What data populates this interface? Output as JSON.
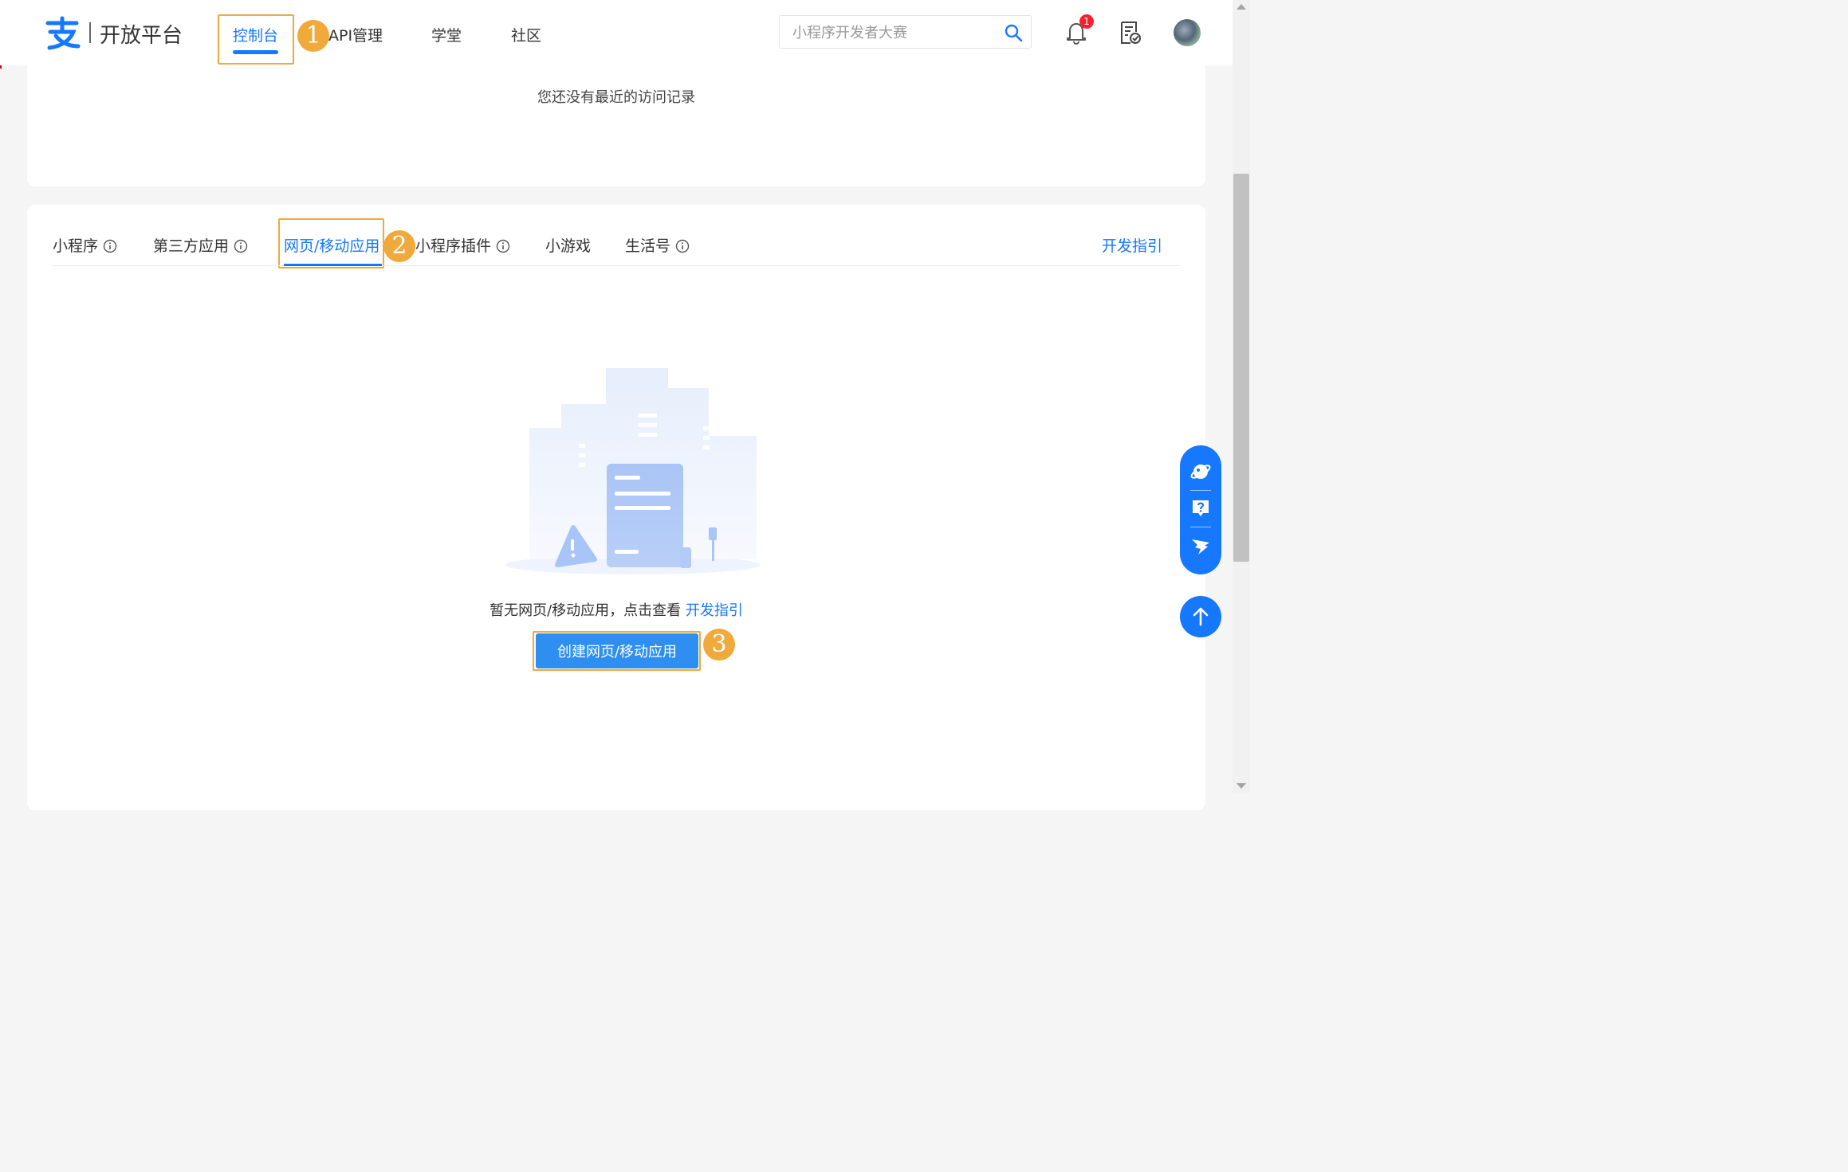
{
  "header": {
    "brand": "开放平台",
    "nav": [
      {
        "label": "控制台",
        "active": true
      },
      {
        "label": "API管理",
        "active": false
      },
      {
        "label": "学堂",
        "active": false
      },
      {
        "label": "社区",
        "active": false
      }
    ],
    "search_placeholder": "小程序开发者大赛",
    "notification_count": "1"
  },
  "recent": {
    "empty_text": "您还没有最近的访问记录"
  },
  "tabs": [
    {
      "label": "小程序",
      "info": true,
      "active": false
    },
    {
      "label": "第三方应用",
      "info": true,
      "active": false
    },
    {
      "label": "网页/移动应用",
      "info": false,
      "active": true
    },
    {
      "label": "小程序插件",
      "info": true,
      "active": false
    },
    {
      "label": "小游戏",
      "info": false,
      "active": false
    },
    {
      "label": "生活号",
      "info": true,
      "active": false
    }
  ],
  "guide_link": "开发指引",
  "empty_state": {
    "text": "暂无网页/移动应用，点击查看",
    "link": "开发指引",
    "button": "创建网页/移动应用"
  },
  "annotations": [
    "1",
    "2",
    "3"
  ],
  "colors": {
    "accent": "#1677ff",
    "highlight": "#f0a93b",
    "badge": "#f5222d",
    "button": "#2e8ff0"
  }
}
